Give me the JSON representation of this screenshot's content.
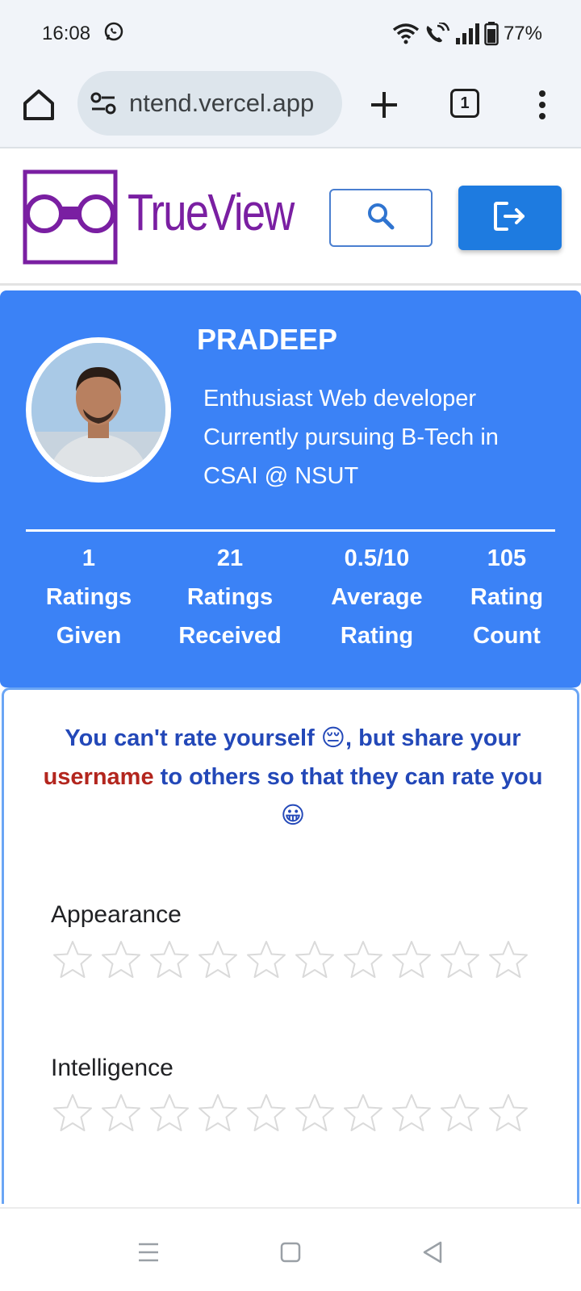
{
  "status_bar": {
    "time": "16:08",
    "battery": "77%",
    "icons": [
      "whatsapp-icon",
      "wifi-icon",
      "wifi-call-icon",
      "signal-icon",
      "battery-icon"
    ]
  },
  "browser": {
    "url": "ntend.vercel.app",
    "tab_count": "1",
    "icons": [
      "home-icon",
      "site-settings-icon",
      "plus-icon",
      "more-vert-icon"
    ]
  },
  "app": {
    "logo_text": "TrueView",
    "brand_color": "#7a1fa2",
    "accent_color": "#3b82f6",
    "button_color": "#1e7be0",
    "icons": [
      "search-icon",
      "logout-icon"
    ]
  },
  "profile": {
    "name": "PRADEEP",
    "bio_lines": [
      "Enthusiast Web developer",
      "Currently pursuing B-Tech in",
      "CSAI @ NSUT"
    ],
    "stats": [
      {
        "value": "1",
        "label": "Ratings Given"
      },
      {
        "value": "21",
        "label": "Ratings Received"
      },
      {
        "value": "0.5/10",
        "label": "Average Rating"
      },
      {
        "value": "105",
        "label": "Rating Count"
      }
    ]
  },
  "rating": {
    "note_part1": "You can't rate yourself 😔, but share your",
    "note_highlight": "username",
    "note_part2": "to others so that they can rate you",
    "note_emoji": "😀",
    "criteria": [
      {
        "label": "Appearance",
        "stars": 10,
        "rated": 0
      },
      {
        "label": "Intelligence",
        "stars": 10,
        "rated": 0
      }
    ]
  },
  "nav": {
    "icons": [
      "recents-icon",
      "home-square-icon",
      "back-icon"
    ]
  }
}
